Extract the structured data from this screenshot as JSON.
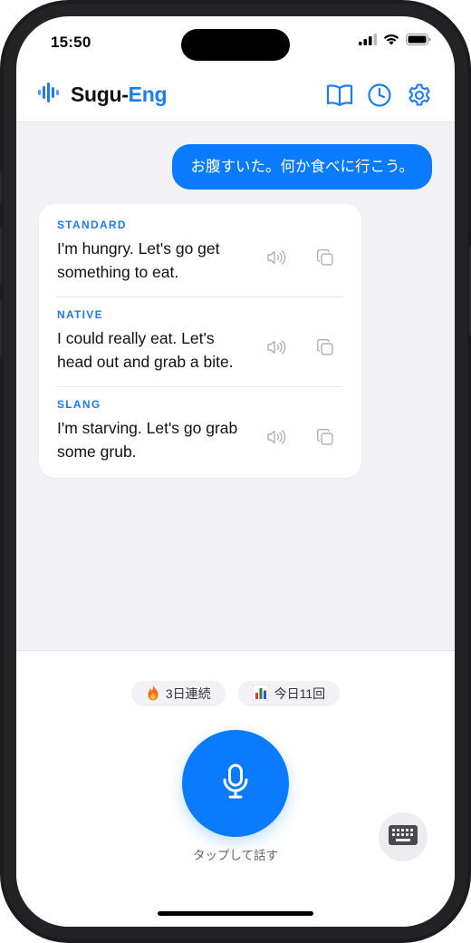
{
  "status_bar": {
    "time": "15:50"
  },
  "app": {
    "brand_part1": "Sugu-",
    "brand_part2": "Eng"
  },
  "header": {
    "icons": [
      "book-icon",
      "history-clock-icon",
      "settings-gear-icon"
    ]
  },
  "chat": {
    "user_message": "お腹すいた。何か食べに行こう。",
    "answers": [
      {
        "label": "STANDARD",
        "text": "I'm hungry. Let's go get something to eat."
      },
      {
        "label": "NATIVE",
        "text": "I could really eat. Let's head out and grab a bite."
      },
      {
        "label": "SLANG",
        "text": "I'm starving. Let's go grab some grub."
      }
    ]
  },
  "stats": {
    "streak_icon": "fire-icon",
    "streak": "3日連続",
    "today_icon": "bar-chart-icon",
    "today": "今日11回"
  },
  "mic": {
    "caption": "タップして話す"
  },
  "colors": {
    "accent": "#0a7bff",
    "chat_bg": "#f1f1f6",
    "label": "#1a7cf2"
  }
}
